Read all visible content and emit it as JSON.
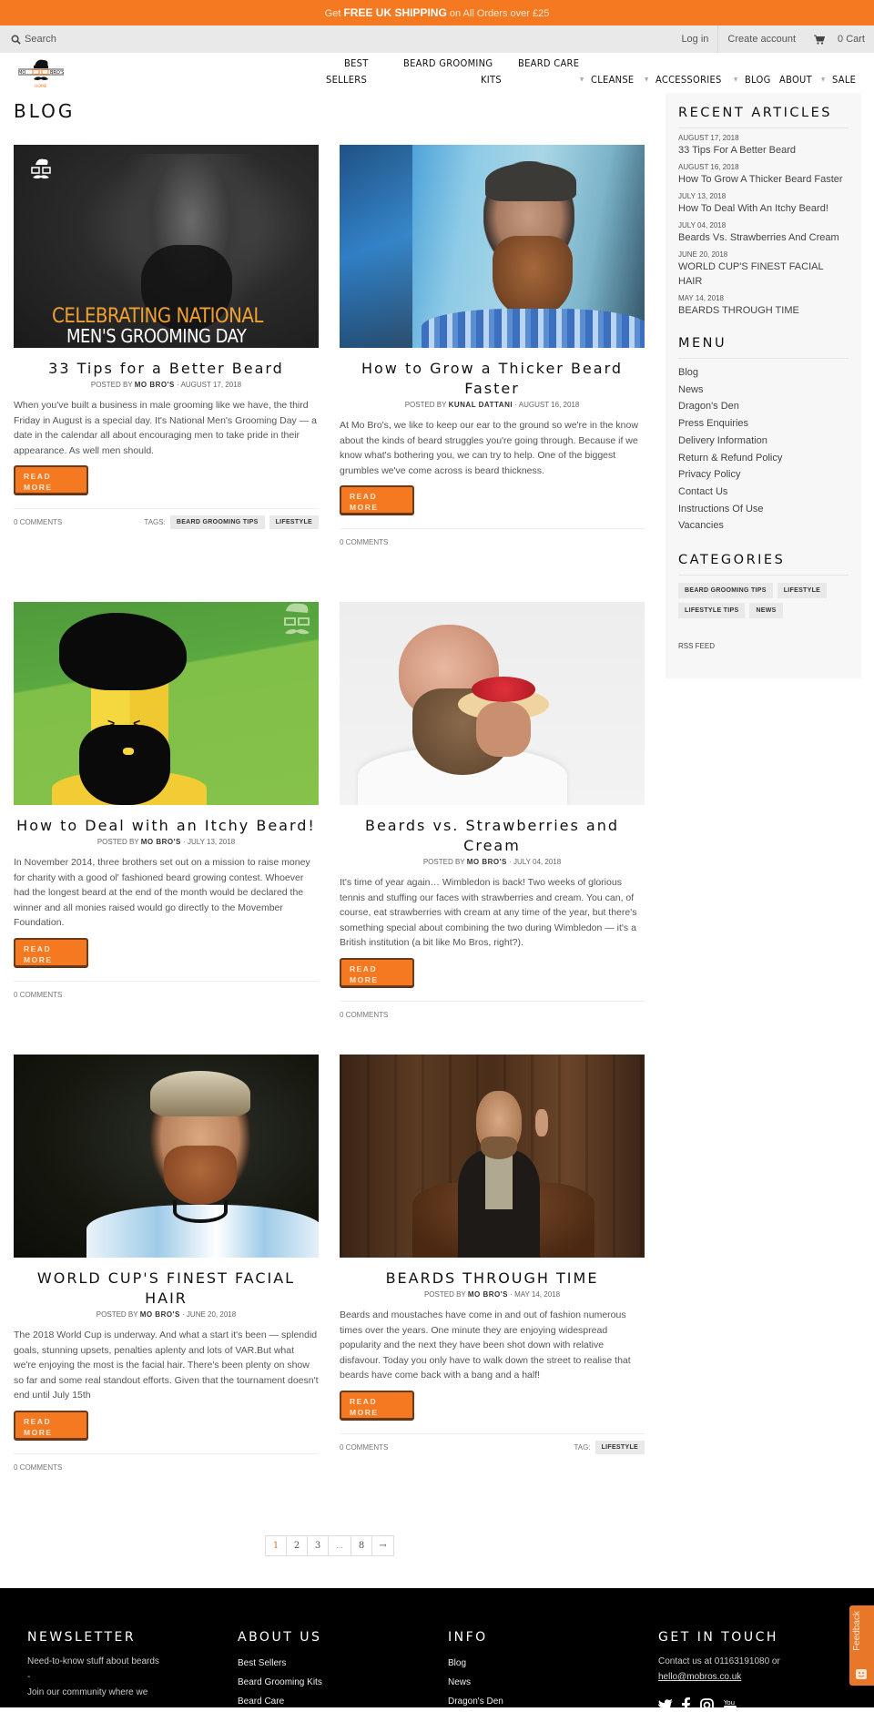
{
  "promo": {
    "prefix": "Get",
    "highlight": "FREE UK SHIPPING",
    "suffix": "on All Orders over £25"
  },
  "utility": {
    "search_label": "Search",
    "login": "Log in",
    "create_account": "Create account",
    "cart": "0 Cart",
    "search_icon": "search-icon",
    "cart_icon": "cart-icon"
  },
  "logo": {
    "left": "MO",
    "right": "BRO'S",
    "home": "HOME"
  },
  "nav": {
    "best_sellers_1": "BEST",
    "best_sellers_2": "SELLERS",
    "kits_1": "BEARD GROOMING",
    "kits_2": "KITS",
    "beard_care": "BEARD CARE",
    "cleanse": "CLEANSE",
    "accessories": "ACCESSORIES",
    "blog": "BLOG",
    "about": "ABOUT",
    "sale": "SALE"
  },
  "page_title": "BLOG",
  "posts": [
    {
      "title": "33 Tips for a Better Beard",
      "posted_by": "POSTED BY",
      "author": "MO BRO'S",
      "date": "AUGUST 17, 2018",
      "excerpt": "When you've built a business in male grooming like we have, the third Friday in August is a special day. It's National Men's Grooming Day — a date in the calendar all about encouraging men to take pride in their appearance. As well men should.",
      "read_more": "READ MORE",
      "comments": "0 COMMENTS",
      "tags_label": "TAGS:",
      "tags": [
        "BEARD GROOMING TIPS",
        "LIFESTYLE"
      ],
      "image_text_1": "CELEBRATING NATIONAL",
      "image_text_2": "MEN'S GROOMING DAY"
    },
    {
      "title": "How to Grow a Thicker Beard Faster",
      "posted_by": "POSTED BY",
      "author": "KUNAL DATTANI",
      "date": "AUGUST 16, 2018",
      "excerpt": "At Mo Bro's, we like to keep our ear to the ground so we're in the know about the kinds of beard struggles you're going through. Because if we know what's bothering you, we can try to help. One of the biggest grumbles we've come across is beard thickness.",
      "read_more": "READ MORE",
      "comments": "0 COMMENTS"
    },
    {
      "title": "How to Deal with an Itchy Beard!",
      "posted_by": "POSTED BY",
      "author": "MO BRO'S",
      "date": "JULY 13, 2018",
      "excerpt": "In November 2014, three brothers set out on a mission to raise money for charity with a good ol' fashioned beard growing contest. Whoever had the longest beard at the end of the month would be declared the winner and all monies raised would go directly to the Movember Foundation.",
      "read_more": "READ MORE",
      "comments": "0 COMMENTS"
    },
    {
      "title": "Beards vs. Strawberries and Cream",
      "posted_by": "POSTED BY",
      "author": "MO BRO'S",
      "date": "JULY 04, 2018",
      "excerpt": "It's time of year again… Wimbledon is back! Two weeks of glorious tennis and stuffing our faces with strawberries and cream. You can, of course, eat strawberries with cream at any time of the year, but there's something special about combining the two during Wimbledon — it's a British institution (a bit like Mo Bros, right?).",
      "read_more": "READ MORE",
      "comments": "0 COMMENTS"
    },
    {
      "title": "WORLD CUP'S FINEST FACIAL HAIR",
      "posted_by": "POSTED BY",
      "author": "MO BRO'S",
      "date": "JUNE 20, 2018",
      "excerpt": "The 2018 World Cup is underway. And what a start it's been — splendid goals, stunning upsets, penalties aplenty and lots of VAR.But what we're enjoying the most is the facial hair. There's been plenty on show so far and some real standout efforts. Given that the tournament doesn't end until July 15th",
      "read_more": "READ MORE",
      "comments": "0 COMMENTS"
    },
    {
      "title": "BEARDS THROUGH TIME",
      "posted_by": "POSTED BY",
      "author": "MO BRO'S",
      "date": "MAY 14, 2018",
      "excerpt": "Beards and moustaches have come in and out of fashion numerous times over the years. One minute they are enjoying widespread popularity and the next they have been shot down with relative disfavour. Today you only have to walk down the street to realise that beards have come back with a bang and a half!",
      "read_more": "READ MORE",
      "comments": "0 COMMENTS",
      "tags_label": "TAG:",
      "tags": [
        "LIFESTYLE"
      ]
    }
  ],
  "sidebar": {
    "recent_title": "RECENT ARTICLES",
    "recent": [
      {
        "date": "AUGUST 17, 2018",
        "title": "33 Tips For A Better Beard"
      },
      {
        "date": "AUGUST 16, 2018",
        "title": "How To Grow A Thicker Beard Faster"
      },
      {
        "date": "JULY 13, 2018",
        "title": "How To Deal With An Itchy Beard!"
      },
      {
        "date": "JULY 04, 2018",
        "title": "Beards Vs. Strawberries And Cream"
      },
      {
        "date": "JUNE 20, 2018",
        "title": "WORLD CUP'S FINEST FACIAL HAIR"
      },
      {
        "date": "MAY 14, 2018",
        "title": "BEARDS THROUGH TIME"
      }
    ],
    "menu_title": "MENU",
    "menu": [
      "Blog",
      "News",
      "Dragon's Den",
      "Press Enquiries",
      "Delivery Information",
      "Return & Refund Policy",
      "Privacy Policy",
      "Contact Us",
      "Instructions Of Use",
      "Vacancies"
    ],
    "categories_title": "CATEGORIES",
    "categories": [
      "BEARD GROOMING TIPS",
      "LIFESTYLE",
      "LIFESTYLE TIPS",
      "NEWS"
    ],
    "rss": "RSS FEED"
  },
  "pagination": {
    "pages": [
      "1",
      "2",
      "3",
      "…",
      "8",
      "→"
    ],
    "current": "1"
  },
  "footer": {
    "newsletter_title": "NEWSLETTER",
    "newsletter_line1": "Need-to-know stuff about beards",
    "newsletter_dash": "-",
    "newsletter_line2": "Join our community where we",
    "about_title": "ABOUT US",
    "about_links": [
      "Best Sellers",
      "Beard Grooming Kits",
      "Beard Care"
    ],
    "info_title": "INFO",
    "info_links": [
      "Blog",
      "News",
      "Dragon's Den"
    ],
    "contact_title": "GET IN TOUCH",
    "contact_text": "Contact us at 01163191080 or",
    "contact_email": "hello@mobros.co.uk",
    "social": [
      "twitter-icon",
      "facebook-icon",
      "instagram-icon",
      "youtube-icon"
    ]
  },
  "feedback": {
    "label": "Feedback"
  },
  "colors": {
    "accent": "#f47920",
    "footer_bg": "#000000",
    "sidebar_bg": "#f7f7f7"
  }
}
